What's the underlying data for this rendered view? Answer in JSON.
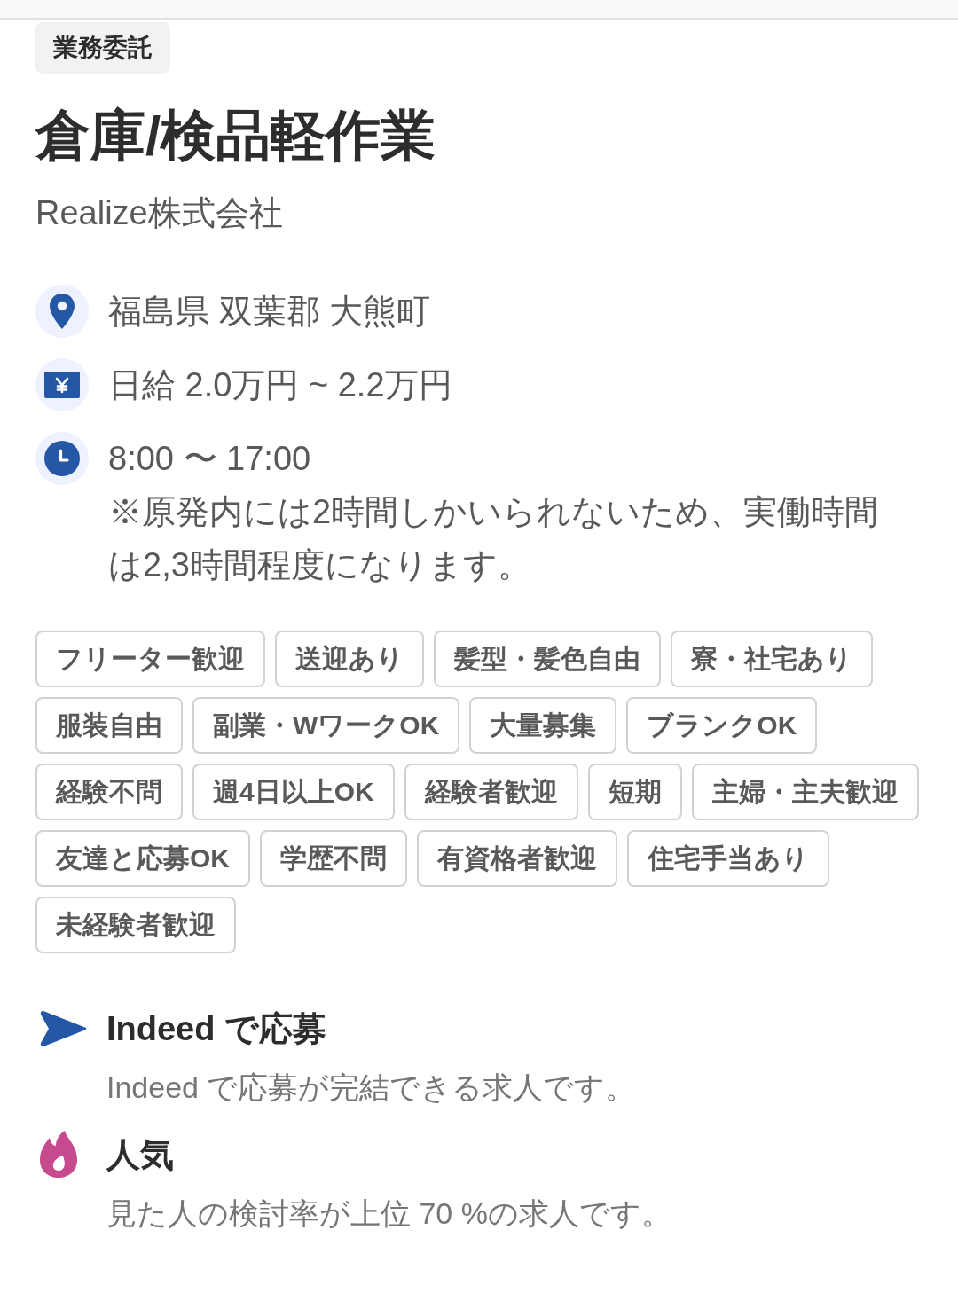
{
  "job_type": "業務委託",
  "title": "倉庫/検品軽作業",
  "company": "Realize株式会社",
  "details": [
    {
      "kind": "location",
      "text": "福島県 双葉郡 大熊町"
    },
    {
      "kind": "salary",
      "text": "日給 2.0万円 ~ 2.2万円"
    },
    {
      "kind": "schedule",
      "text": "8:00 〜 17:00",
      "note": "※原発内には2時間しかいられないため、実働時間は2,3時間程度になります。"
    }
  ],
  "tags": [
    "フリーター歓迎",
    "送迎あり",
    "髪型・髪色自由",
    "寮・社宅あり",
    "服装自由",
    "副業・WワークOK",
    "大量募集",
    "ブランクOK",
    "経験不問",
    "週4日以上OK",
    "経験者歓迎",
    "短期",
    "主婦・主夫歓迎",
    "友達と応募OK",
    "学歴不問",
    "有資格者歓迎",
    "住宅手当あり",
    "未経験者歓迎"
  ],
  "features": [
    {
      "kind": "apply",
      "title": "Indeed で応募",
      "description": "Indeed で応募が完結できる求人です。"
    },
    {
      "kind": "popular",
      "title": "人気",
      "description": "見た人の検討率が上位 70 %の求人です。"
    }
  ]
}
